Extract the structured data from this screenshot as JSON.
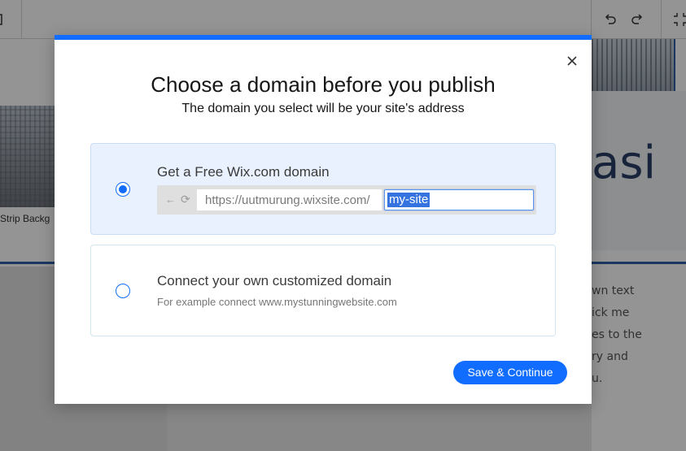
{
  "background": {
    "strip_label": "Strip Backg",
    "heading_fragment": "asi",
    "text_lines": [
      "wn text",
      "ick me",
      "es to the",
      "ry and",
      "u."
    ]
  },
  "modal": {
    "title": "Choose a domain before you publish",
    "subtitle": "The domain you select will be your site's address",
    "close_icon": "close-icon",
    "options": {
      "free": {
        "label": "Get a Free Wix.com domain",
        "selected": true,
        "url_prefix": "https://uutmurung.wixsite.com/",
        "site_name_value": "my-site"
      },
      "custom": {
        "label": "Connect your own customized domain",
        "example": "For example connect www.mystunningwebsite.com",
        "selected": false
      }
    },
    "save_button": "Save & Continue"
  },
  "colors": {
    "accent": "#116dff",
    "selected_option_bg": "#e8f1fd",
    "overlay": "rgba(0,0,0,0.42)"
  }
}
